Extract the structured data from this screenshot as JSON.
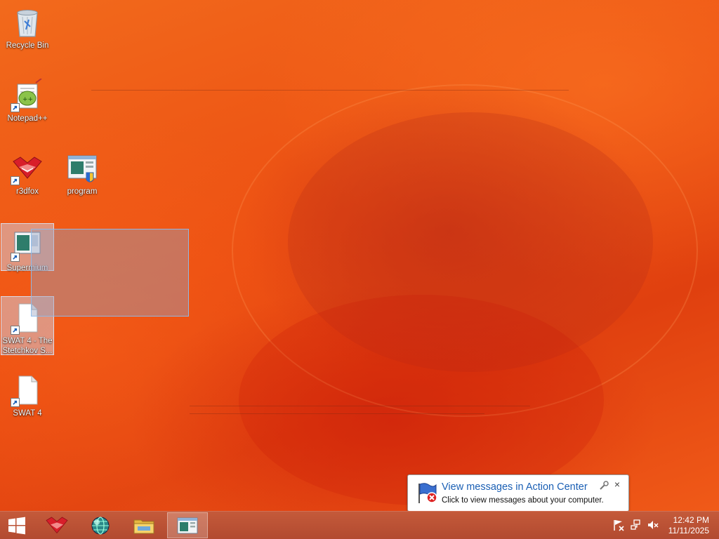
{
  "desktop": {
    "icons": [
      {
        "label": "Recycle Bin",
        "icon": "recycle-bin-icon"
      },
      {
        "label": "Notepad++",
        "icon": "notepad-plus-plus-icon"
      },
      {
        "label": "r3dfox",
        "icon": "r3dfox-icon"
      },
      {
        "label": "program",
        "icon": "program-icon"
      },
      {
        "label": "Supermium",
        "icon": "supermium-icon"
      },
      {
        "label": "SWAT 4 - The Stetchkov S...",
        "icon": "file-shortcut-icon"
      },
      {
        "label": "SWAT 4",
        "icon": "file-shortcut-icon"
      }
    ]
  },
  "taskbar": {
    "start": "start-button",
    "pinned": [
      {
        "name": "r3dfox",
        "icon": "r3dfox-icon",
        "active": false
      },
      {
        "name": "Supermium browser",
        "icon": "browser-globe-icon",
        "active": false
      },
      {
        "name": "File Explorer",
        "icon": "folder-icon",
        "active": false
      },
      {
        "name": "program",
        "icon": "program-icon",
        "active": true
      }
    ],
    "tray": {
      "icons": [
        "action-center-flag-icon",
        "network-icon",
        "speaker-muted-icon"
      ],
      "time": "12:42 PM",
      "date": "11/11/2025"
    }
  },
  "notification": {
    "title": "View messages in Action Center",
    "text": "Click to view messages about your computer.",
    "close": "×"
  },
  "colors": {
    "wallpaper": "#ec4e12",
    "taskbar": "#b24a30",
    "link": "#1a5fb4"
  }
}
